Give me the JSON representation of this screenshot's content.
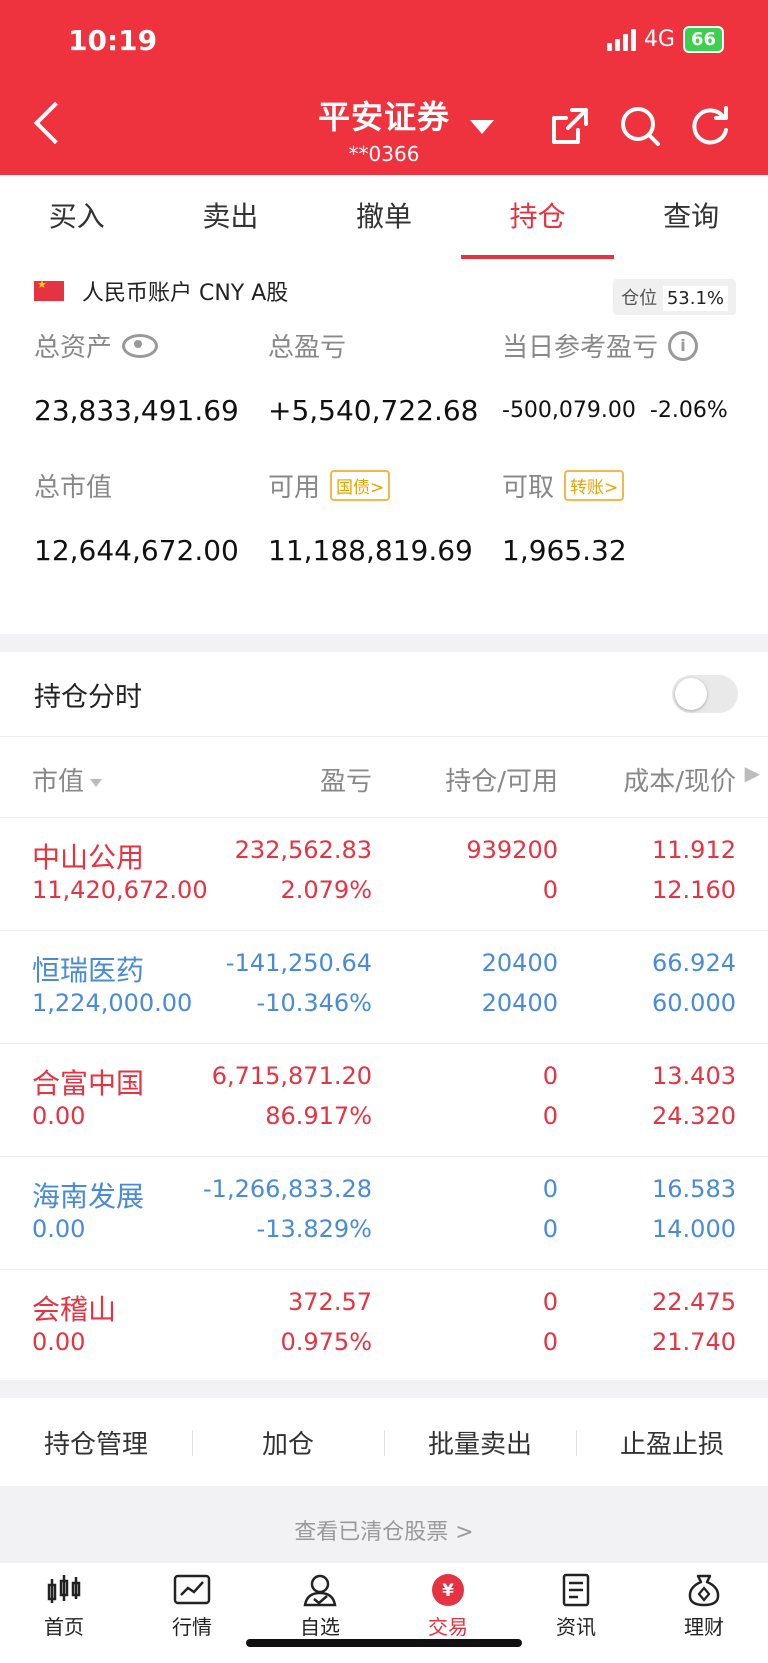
{
  "status": {
    "time": "10:19",
    "network": "4G",
    "battery": "66"
  },
  "header": {
    "broker": "平安证券",
    "account": "**0366"
  },
  "tabs": [
    "买入",
    "卖出",
    "撤单",
    "持仓",
    "查询"
  ],
  "account": {
    "label": "人民币账户 CNY A股",
    "position_label": "仓位",
    "position_value": "53.1%"
  },
  "summary": {
    "total_assets_label": "总资产",
    "total_assets": "23,833,491.69",
    "total_pnl_label": "总盈亏",
    "total_pnl": "+5,540,722.68",
    "daily_ref_label": "当日参考盈亏",
    "daily_ref_value": "-500,079.00",
    "daily_ref_pct": "-2.06%",
    "market_value_label": "总市值",
    "market_value": "12,644,672.00",
    "available_label": "可用",
    "available_tag": "国债>",
    "available": "11,188,819.69",
    "withdrawable_label": "可取",
    "withdrawable_tag": "转账>",
    "withdrawable": "1,965.32"
  },
  "holdings": {
    "title": "持仓分时",
    "columns": [
      "市值",
      "盈亏",
      "持仓/可用",
      "成本/现价"
    ],
    "rows": [
      {
        "name": "中山公用",
        "mv": "11,420,672.00",
        "pnl": "232,562.83",
        "pnl_pct": "2.079%",
        "pos": "939200",
        "avail": "0",
        "cost": "11.912",
        "price": "12.160",
        "color": "red"
      },
      {
        "name": "恒瑞医药",
        "mv": "1,224,000.00",
        "pnl": "-141,250.64",
        "pnl_pct": "-10.346%",
        "pos": "20400",
        "avail": "20400",
        "cost": "66.924",
        "price": "60.000",
        "color": "blue"
      },
      {
        "name": "合富中国",
        "mv": "0.00",
        "pnl": "6,715,871.20",
        "pnl_pct": "86.917%",
        "pos": "0",
        "avail": "0",
        "cost": "13.403",
        "price": "24.320",
        "color": "red"
      },
      {
        "name": "海南发展",
        "mv": "0.00",
        "pnl": "-1,266,833.28",
        "pnl_pct": "-13.829%",
        "pos": "0",
        "avail": "0",
        "cost": "16.583",
        "price": "14.000",
        "color": "blue"
      },
      {
        "name": "会稽山",
        "mv": "0.00",
        "pnl": "372.57",
        "pnl_pct": "0.975%",
        "pos": "0",
        "avail": "0",
        "cost": "22.475",
        "price": "21.740",
        "color": "red"
      }
    ]
  },
  "actions": [
    "持仓管理",
    "加仓",
    "批量卖出",
    "止盈止损"
  ],
  "cleared_link": "查看已清仓股票 >",
  "nav": [
    "首页",
    "行情",
    "自选",
    "交易",
    "资讯",
    "理财"
  ],
  "nav_trade_glyph": "¥",
  "colors": {
    "brand_red": "#ee333f",
    "up": "#e63341",
    "down": "#4a8ad8",
    "tag": "#e6a400"
  }
}
